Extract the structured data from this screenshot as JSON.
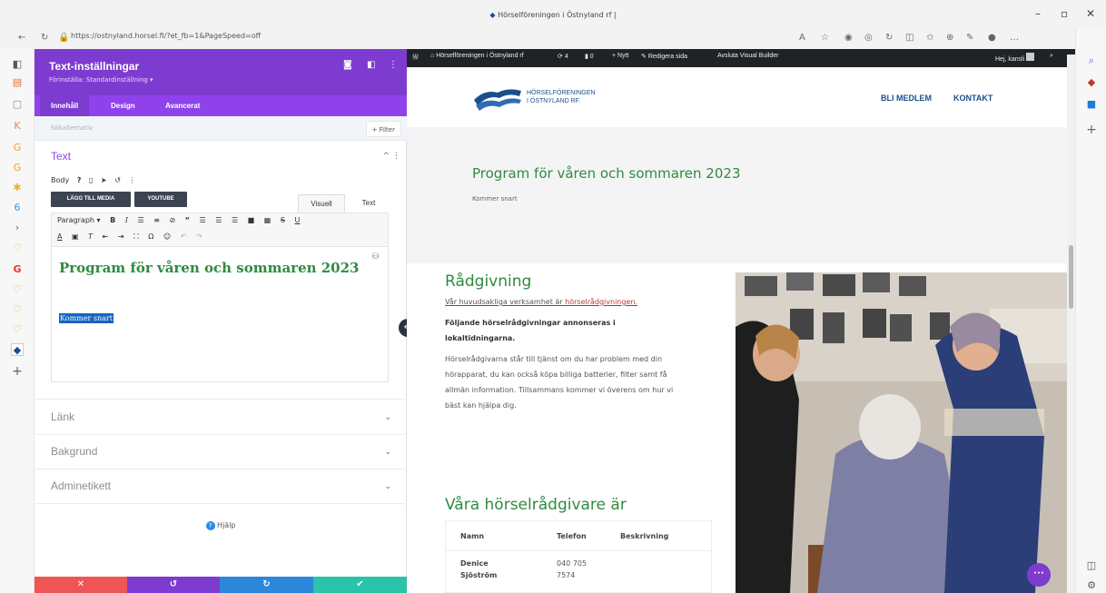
{
  "browser": {
    "tab_title": "Hörselföreningen i Östnyland rf |",
    "url": "https://ostnyland.horsel.fi/?et_fb=1&PageSpeed=off"
  },
  "panel": {
    "title": "Text-inställningar",
    "subtitle": "Förinställa: Standardinställning",
    "tabs": [
      "Innehåll",
      "Design",
      "Avancerat"
    ],
    "search_placeholder": "Sökalternativ",
    "filter_label": "+ Filter",
    "sections": {
      "text": "Text",
      "link": "Länk",
      "background": "Bakgrund",
      "admin_label": "Adminetikett"
    },
    "body_label": "Body",
    "add_media": "LÄGG TILL MEDIA",
    "youtube": "YOUTUBE",
    "mode_visual": "Visuell",
    "mode_text": "Text",
    "paragraph_select": "Paragraph",
    "editor_heading": "Program för våren och sommaren 2023",
    "editor_selected_text": "Kommer snart",
    "help": "Hjälp"
  },
  "wpbar": {
    "site_name": "Hörselföreningen i Östnyland rf",
    "updates": "4",
    "comments": "0",
    "new": "Nytt",
    "edit_page": "Redigera sida",
    "exit_builder": "Avsluta Visual Builder",
    "greeting": "Hej, kansli"
  },
  "site": {
    "logo_line1": "HÖRSELFÖRENINGEN",
    "logo_line2": "I ÖSTNYLAND RF.",
    "nav": [
      "BLI MEDLEM",
      "KONTAKT"
    ],
    "hero_heading": "Program för våren och sommaren 2023",
    "hero_sub": "Kommer snart",
    "section_heading": "Rådgivning",
    "intro_prefix": "Vår huvudsakliga verksamhet är ",
    "intro_link": "hörselrådgivningen.",
    "bold_para": "Följande hörselrådgivningar annonseras i lokaltidningarna.",
    "para": "Hörselrådgivarna står till tjänst om du har problem med din hörapparat, du kan också köpa billiga batterier, filter samt få allmän information. Tillsammans kommer vi överens om hur vi bäst kan hjälpa dig.",
    "advisors_heading": "Våra hörselrådgivare är",
    "table_headers": [
      "Namn",
      "Telefon",
      "Beskrivning"
    ],
    "table_row": {
      "name_line1": "Denice",
      "name_line2": "Sjöström",
      "phone_line1": "040 705",
      "phone_line2": "7574"
    }
  },
  "colors": {
    "divi_purple": "#7e3bd0",
    "divi_purple_light": "#8f42ec",
    "site_green": "#2e8b3e",
    "site_blue": "#1b4f8c",
    "wp_bar": "#1d2327"
  }
}
